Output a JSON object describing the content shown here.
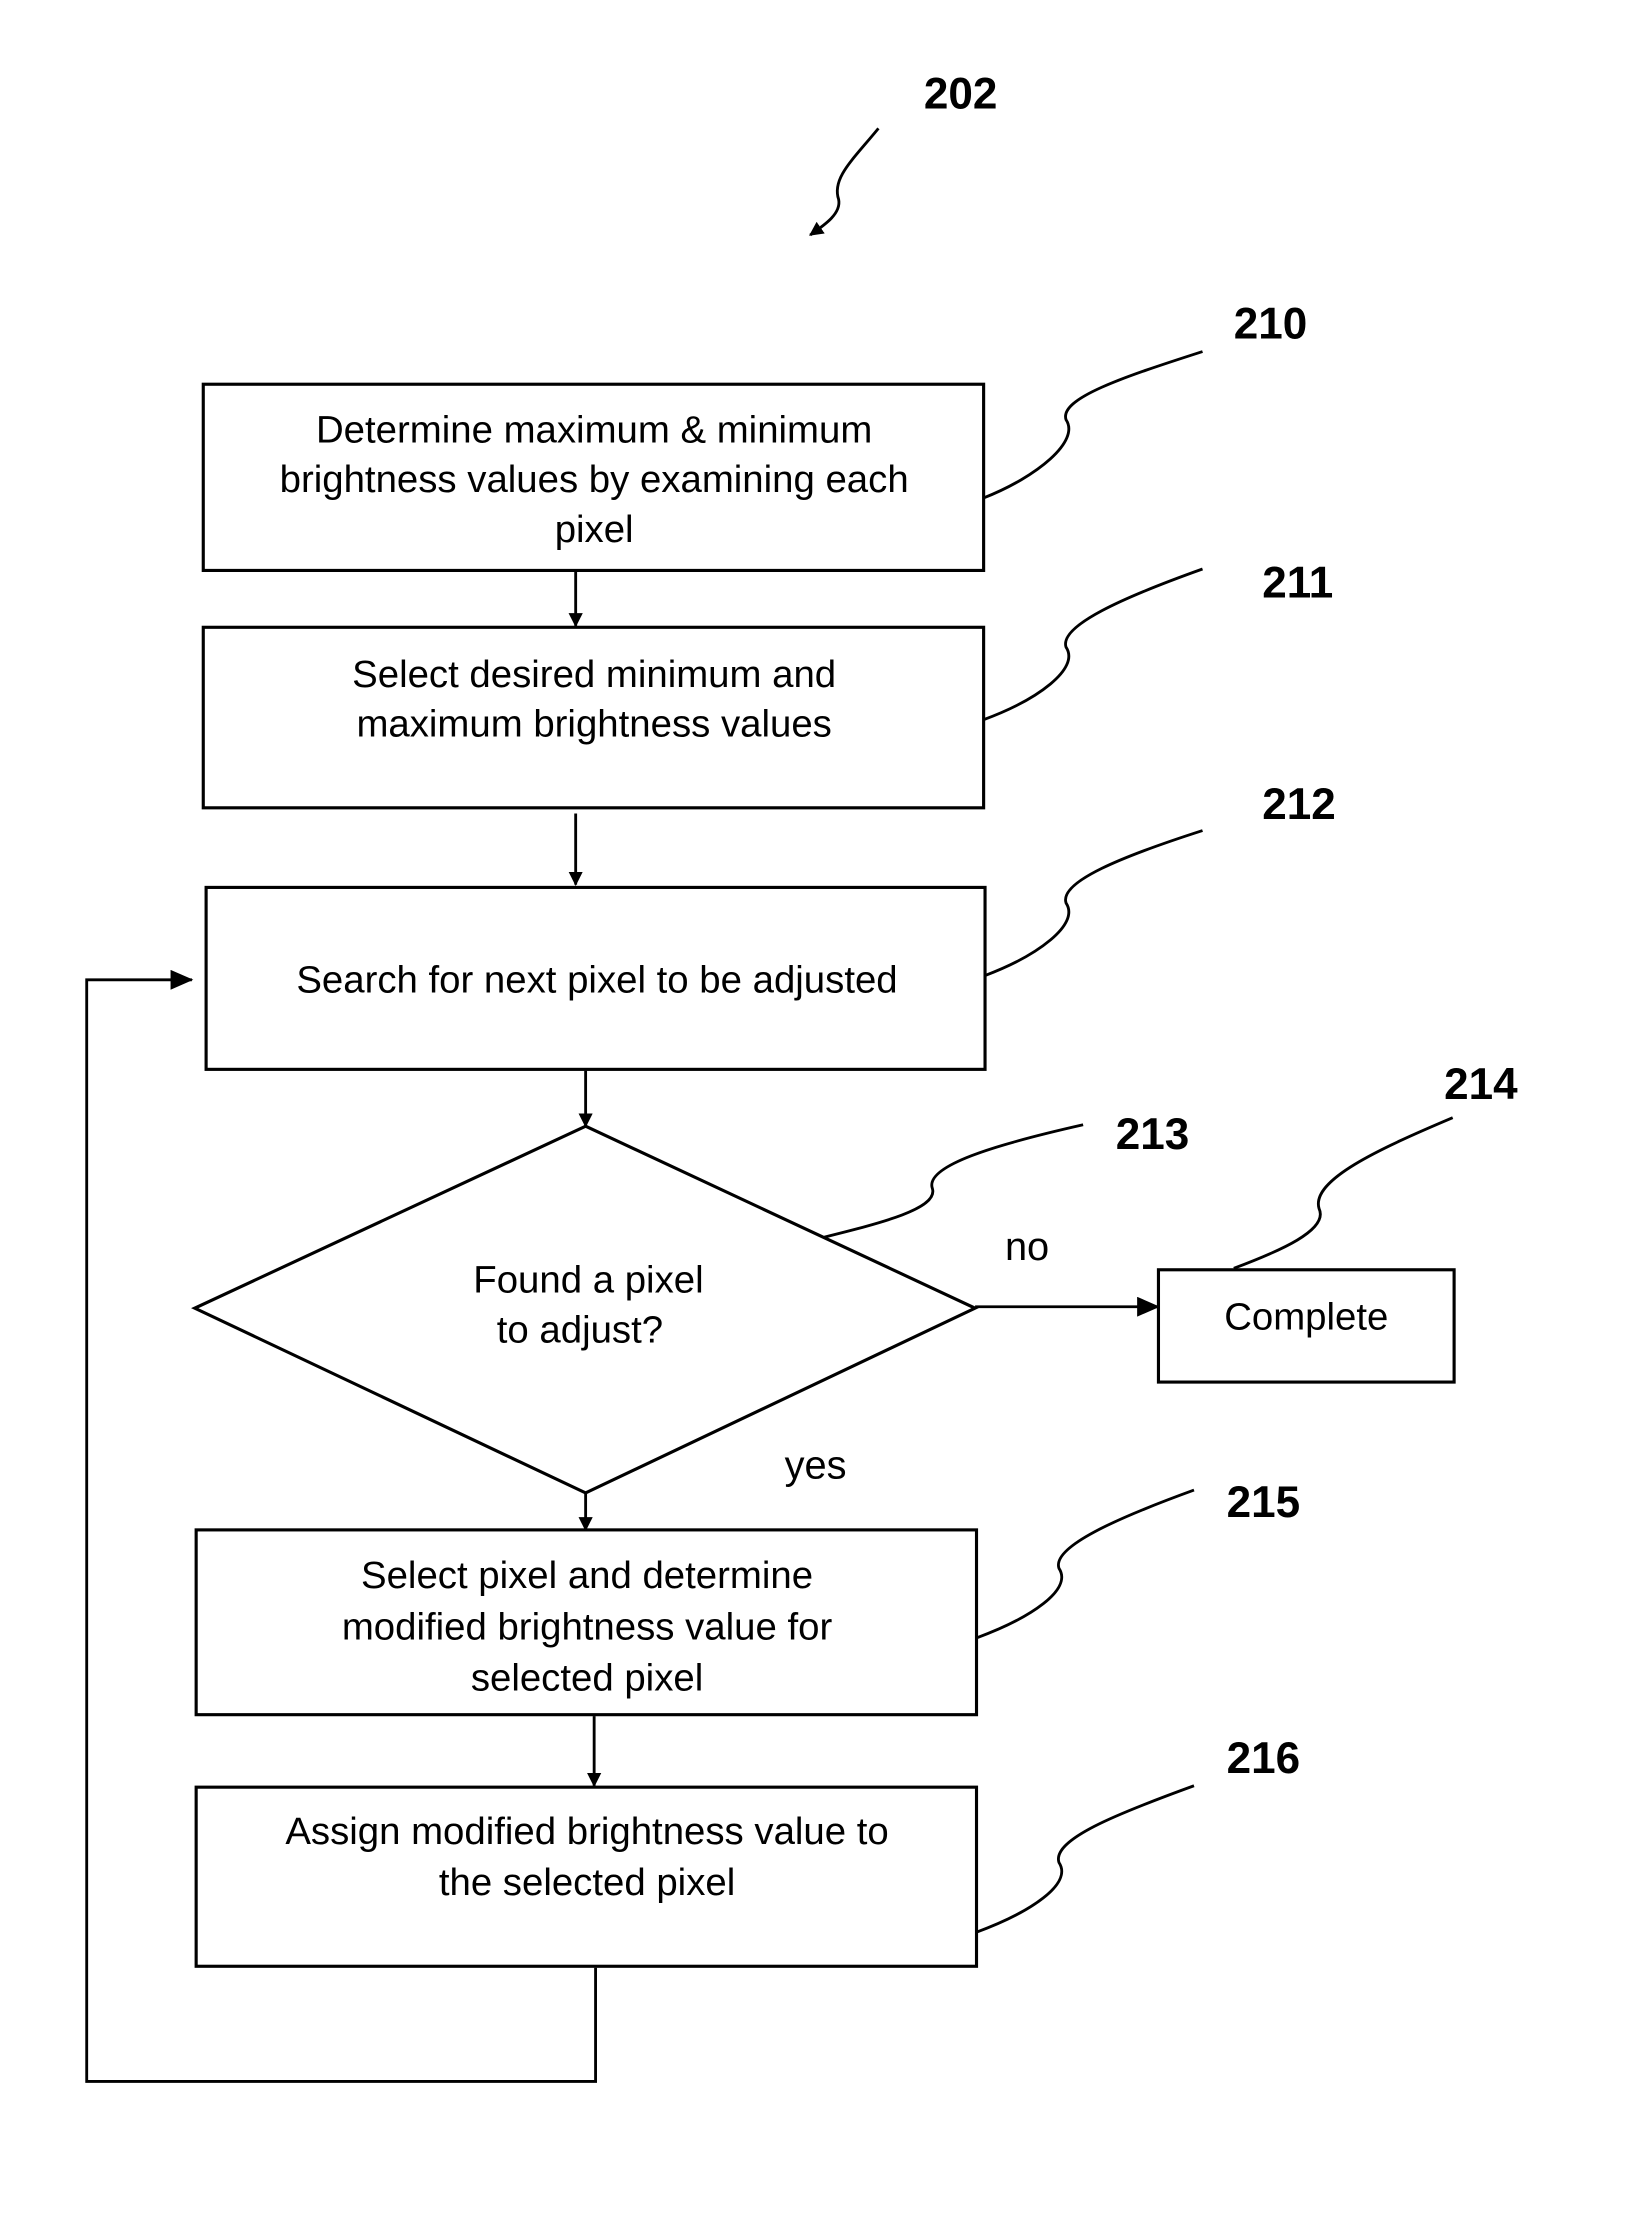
{
  "figure": {
    "ref": "202",
    "steps": [
      {
        "id": "210",
        "lines": [
          "Determine maximum & minimum",
          "brightness values by examining each",
          "pixel"
        ]
      },
      {
        "id": "211",
        "lines": [
          "Select desired minimum and",
          "maximum brightness values"
        ]
      },
      {
        "id": "212",
        "lines": [
          "Search for next pixel to be adjusted"
        ]
      },
      {
        "id": "213",
        "lines": [
          "Found a pixel",
          "to adjust?"
        ]
      },
      {
        "id": "214",
        "lines": [
          "Complete"
        ]
      },
      {
        "id": "215",
        "lines": [
          "Select pixel and determine",
          "modified brightness value for",
          "selected pixel"
        ]
      },
      {
        "id": "216",
        "lines": [
          "Assign modified brightness value to",
          "the selected pixel"
        ]
      }
    ],
    "branch_labels": {
      "no": "no",
      "yes": "yes"
    }
  }
}
